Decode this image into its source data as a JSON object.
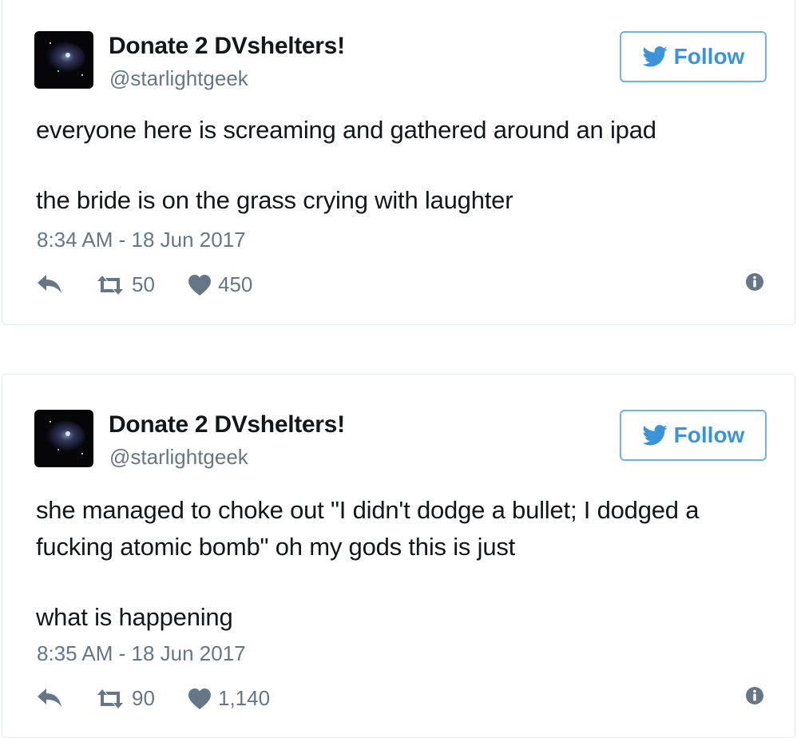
{
  "colors": {
    "accent": "#3b94d9",
    "follow_border": "#6fb3e6",
    "secondary_text": "#657786",
    "primary_text": "#14171a",
    "card_border": "#e1e8ed"
  },
  "tweets": [
    {
      "display_name": "Donate 2 DVshelters!",
      "handle": "@starlightgeek",
      "follow_label": "Follow",
      "paragraphs": [
        "everyone here is screaming and gathered around an ipad",
        "the bride is on the grass crying with laughter"
      ],
      "timestamp": "8:34 AM - 18 Jun 2017",
      "retweets": "50",
      "likes": "450",
      "icons": {
        "reply": "reply-icon",
        "retweet": "retweet-icon",
        "like": "heart-icon",
        "more": "info-icon",
        "follow": "twitter-bird-icon"
      }
    },
    {
      "display_name": "Donate 2 DVshelters!",
      "handle": "@starlightgeek",
      "follow_label": "Follow",
      "paragraphs": [
        "she managed to choke out \"I didn't dodge a bullet; I dodged a fucking atomic bomb\" oh my gods this is just",
        "what is happening"
      ],
      "timestamp": "8:35 AM - 18 Jun 2017",
      "retweets": "90",
      "likes": "1,140",
      "icons": {
        "reply": "reply-icon",
        "retweet": "retweet-icon",
        "like": "heart-icon",
        "more": "info-icon",
        "follow": "twitter-bird-icon"
      }
    }
  ]
}
